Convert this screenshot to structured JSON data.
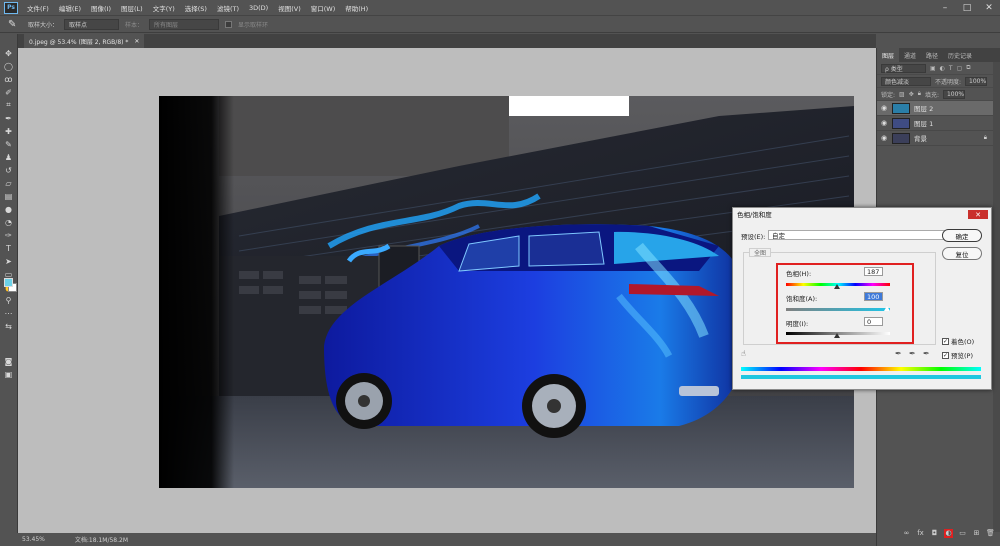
{
  "menu": {
    "logo": "Ps",
    "items": [
      "文件(F)",
      "编辑(E)",
      "图像(I)",
      "图层(L)",
      "文字(Y)",
      "选择(S)",
      "滤镜(T)",
      "3D(D)",
      "视图(V)",
      "窗口(W)",
      "帮助(H)"
    ]
  },
  "options": {
    "sample_size_label": "取样大小：",
    "sample_size_value": "取样点",
    "sample_label": "样本：",
    "sample_value": "所有图层",
    "show_ring_label": "显示取样环"
  },
  "document": {
    "tab_title": "0.jpeg @ 53.4% (图层 2, RGB/8) *",
    "zoom": "53.45%",
    "doc_info": "文档:18.1M/58.2M"
  },
  "layers_panel": {
    "tabs": [
      "图层",
      "通道",
      "路径",
      "历史记录"
    ],
    "filter_kind": "ρ 类型",
    "blend_mode": "颜色减淡",
    "opacity_label": "不透明度:",
    "opacity_value": "100%",
    "lock_label": "锁定:",
    "fill_label": "填充:",
    "fill_value": "100%",
    "layers": [
      {
        "name": "图层 2",
        "selected": true,
        "thumb": "#2a7ea8"
      },
      {
        "name": "图层 1",
        "selected": false,
        "thumb": "#3f4c83"
      },
      {
        "name": "背景",
        "selected": false,
        "thumb": "#3b3f5a",
        "locked": true
      }
    ]
  },
  "dialog": {
    "title": "色相/饱和度",
    "preset_label": "预设(E):",
    "preset_value": "自定",
    "ok_label": "确定",
    "cancel_label": "复位",
    "channel_value": "全图",
    "hue_label": "色相(H):",
    "hue_value": "187",
    "saturation_label": "饱和度(A):",
    "saturation_value": "100",
    "lightness_label": "明度(I):",
    "lightness_value": "0",
    "colorize_label": "着色(O)",
    "colorize_checked": true,
    "preview_label": "预览(P)",
    "preview_checked": true
  },
  "colors": {
    "foreground": "#6cd2e8",
    "background": "#ffffff",
    "highlight": "#e02020"
  }
}
